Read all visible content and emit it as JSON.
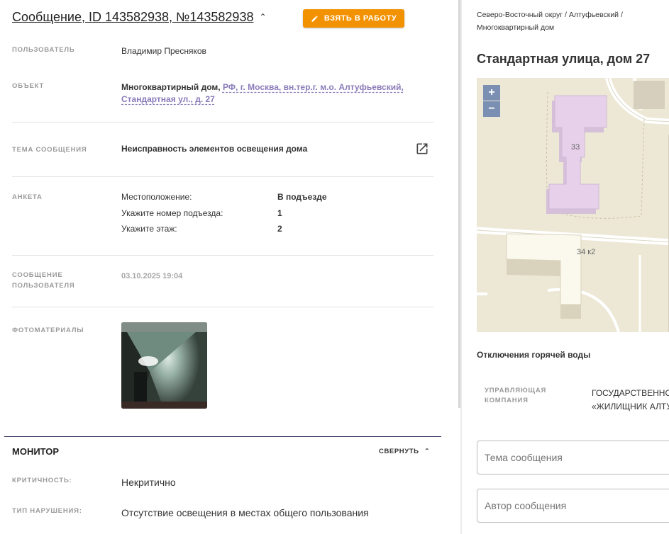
{
  "message": {
    "title": "Сообщение, ID 143582938, №143582938",
    "take_button": "ВЗЯТЬ В РАБОТУ",
    "fields": {
      "user_label": "ПОЛЬЗОВАТЕЛЬ",
      "user_value": "Владимир Пресняков",
      "object_label": "ОБЪЕКТ",
      "object_type": "Многоквартирный дом,",
      "object_address_line1": "РФ, г. Москва, вн.тер.г. м.о. Алтуфьевский,",
      "object_address_line2": "Стандартная ул., д. 27",
      "topic_label": "ТЕМА СООБЩЕНИЯ",
      "topic_value": "Неисправность элементов освещения дома",
      "survey_label": "АНКЕТА",
      "survey": [
        {
          "q": "Местоположение:",
          "a": "В подъезде"
        },
        {
          "q": "Укажите номер подъезда:",
          "a": "1"
        },
        {
          "q": "Укажите этаж:",
          "a": "2"
        }
      ],
      "user_message_label_1": "СООБЩЕНИЕ",
      "user_message_label_2": "ПОЛЬЗОВАТЕЛЯ",
      "user_message_date": "03.10.2025 19:04",
      "photos_label": "ФОТОМАТЕРИАЛЫ"
    }
  },
  "monitor": {
    "title": "МОНИТОР",
    "collapse": "СВЕРНУТЬ",
    "criticality_label": "КРИТИЧНОСТЬ:",
    "criticality_value": "Некритично",
    "violation_label": "ТИП НАРУШЕНИЯ:",
    "violation_value": "Отсутствие освещения в местах общего пользования"
  },
  "sidebar": {
    "breadcrumb_1": "Северо-Восточный округ / Алтуфьевский /",
    "breadcrumb_2": "Многоквартирный дом",
    "address": "Стандартная улица, дом 27",
    "map": {
      "zoom_in": "+",
      "zoom_out": "−",
      "building_1_label": "33",
      "building_2_label": "34 к2"
    },
    "hot_water": "Отключения горячей воды",
    "mgmt_label_1": "УПРАВЛЯЮЩАЯ",
    "mgmt_label_2": "КОМПАНИЯ",
    "mgmt_value_1": "ГОСУДАРСТВЕННО",
    "mgmt_value_2": "«ЖИЛИЩНИК АЛТУ",
    "topic_placeholder": "Тема сообщения",
    "author_placeholder": "Автор сообщения"
  },
  "colors": {
    "accent": "#f39200",
    "link": "#8a7bb9",
    "map_bg": "#ede8d6",
    "map_building": "#e0c9e6"
  }
}
